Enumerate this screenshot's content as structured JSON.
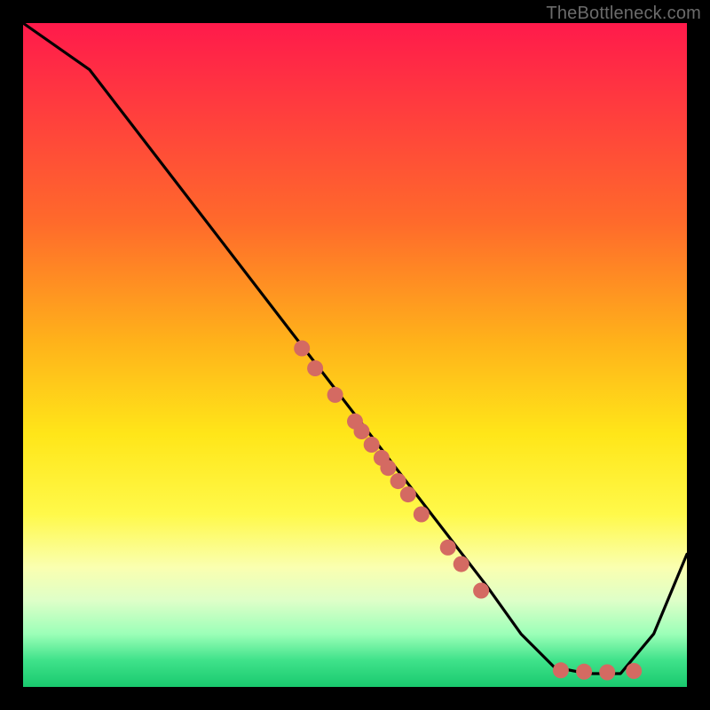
{
  "watermark": "TheBottleneck.com",
  "chart_data": {
    "type": "line",
    "title": "",
    "xlabel": "",
    "ylabel": "",
    "xlim": [
      0,
      100
    ],
    "ylim": [
      0,
      100
    ],
    "grid": false,
    "legend": false,
    "series": [
      {
        "name": "curve",
        "x": [
          0,
          10,
          20,
          30,
          40,
          50,
          60,
          70,
          75,
          80,
          85,
          90,
          95,
          100
        ],
        "y": [
          100,
          93,
          80,
          67,
          54,
          41,
          28,
          15,
          8,
          3,
          2,
          2,
          8,
          20
        ]
      }
    ],
    "points": [
      {
        "x": 42,
        "y": 51
      },
      {
        "x": 44,
        "y": 48
      },
      {
        "x": 47,
        "y": 44
      },
      {
        "x": 50,
        "y": 40
      },
      {
        "x": 51,
        "y": 38.5
      },
      {
        "x": 52.5,
        "y": 36.5
      },
      {
        "x": 54,
        "y": 34.5
      },
      {
        "x": 55,
        "y": 33
      },
      {
        "x": 56.5,
        "y": 31
      },
      {
        "x": 58,
        "y": 29
      },
      {
        "x": 60,
        "y": 26
      },
      {
        "x": 64,
        "y": 21
      },
      {
        "x": 66,
        "y": 18.5
      },
      {
        "x": 69,
        "y": 14.5
      },
      {
        "x": 81,
        "y": 2.5
      },
      {
        "x": 84.5,
        "y": 2.3
      },
      {
        "x": 88,
        "y": 2.2
      },
      {
        "x": 92,
        "y": 2.4
      }
    ],
    "point_color": "#d46a62",
    "point_radius_px": 9,
    "curve_color": "#000000",
    "area_ratio_plot_to_stage": 0.935
  }
}
